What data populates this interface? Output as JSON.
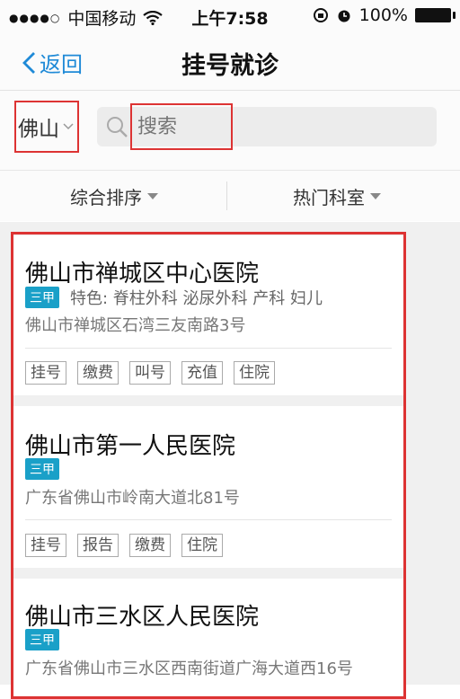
{
  "status_bar": {
    "carrier": "中国移动",
    "time": "上午7:58",
    "battery": "100%"
  },
  "nav": {
    "back_label": "返回",
    "title": "挂号就诊"
  },
  "search": {
    "city": "佛山",
    "placeholder": "搜索"
  },
  "filters": [
    {
      "label": "综合排序"
    },
    {
      "label": "热门科室"
    }
  ],
  "hospitals": [
    {
      "name": "佛山市禅城区中心医院",
      "grade": "三甲",
      "specialty": "特色: 脊柱外科  泌尿外科  产科  妇儿",
      "address": "佛山市禅城区石湾三友南路3号",
      "tags": [
        "挂号",
        "缴费",
        "叫号",
        "充值",
        "住院"
      ]
    },
    {
      "name": "佛山市第一人民医院",
      "grade": "三甲",
      "specialty": "",
      "address": "广东省佛山市岭南大道北81号",
      "tags": [
        "挂号",
        "报告",
        "缴费",
        "住院"
      ]
    },
    {
      "name": "佛山市三水区人民医院",
      "grade": "三甲",
      "specialty": "",
      "address": "广东省佛山市三水区西南街道广海大道西16号",
      "tags": []
    }
  ]
}
